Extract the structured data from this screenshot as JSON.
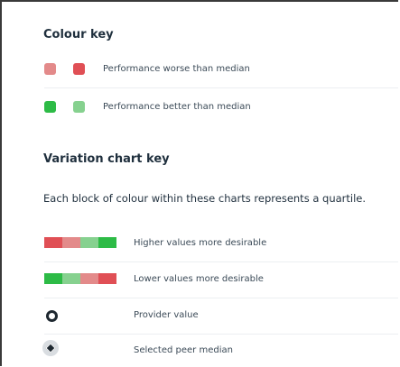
{
  "colour_key": {
    "heading": "Colour key",
    "rows": [
      {
        "label": "Performance worse than median",
        "swatch_colors": [
          "#e38a8a",
          "#e04f55"
        ]
      },
      {
        "label": "Performance better than median",
        "swatch_colors": [
          "#2dbb46",
          "#86d18f"
        ]
      }
    ]
  },
  "variation_key": {
    "heading": "Variation chart key",
    "description": "Each block of colour within these charts represents a quartile.",
    "rows": [
      {
        "label": "Higher values more desirable",
        "icon": "quartile-bar-higher-icon",
        "colors": [
          "#e04f55",
          "#e38a8a",
          "#86d18f",
          "#2dbb46"
        ]
      },
      {
        "label": "Lower values more desirable",
        "icon": "quartile-bar-lower-icon",
        "colors": [
          "#2dbb46",
          "#86d18f",
          "#e38a8a",
          "#e04f55"
        ]
      },
      {
        "label": "Provider value",
        "icon": "provider-ring-icon"
      },
      {
        "label": "Selected peer median",
        "icon": "peer-median-diamond-icon"
      }
    ]
  },
  "colors": {
    "red_dark": "#e04f55",
    "red_light": "#e38a8a",
    "green_dark": "#2dbb46",
    "green_light": "#86d18f",
    "heading_text": "#1f2f3d"
  }
}
